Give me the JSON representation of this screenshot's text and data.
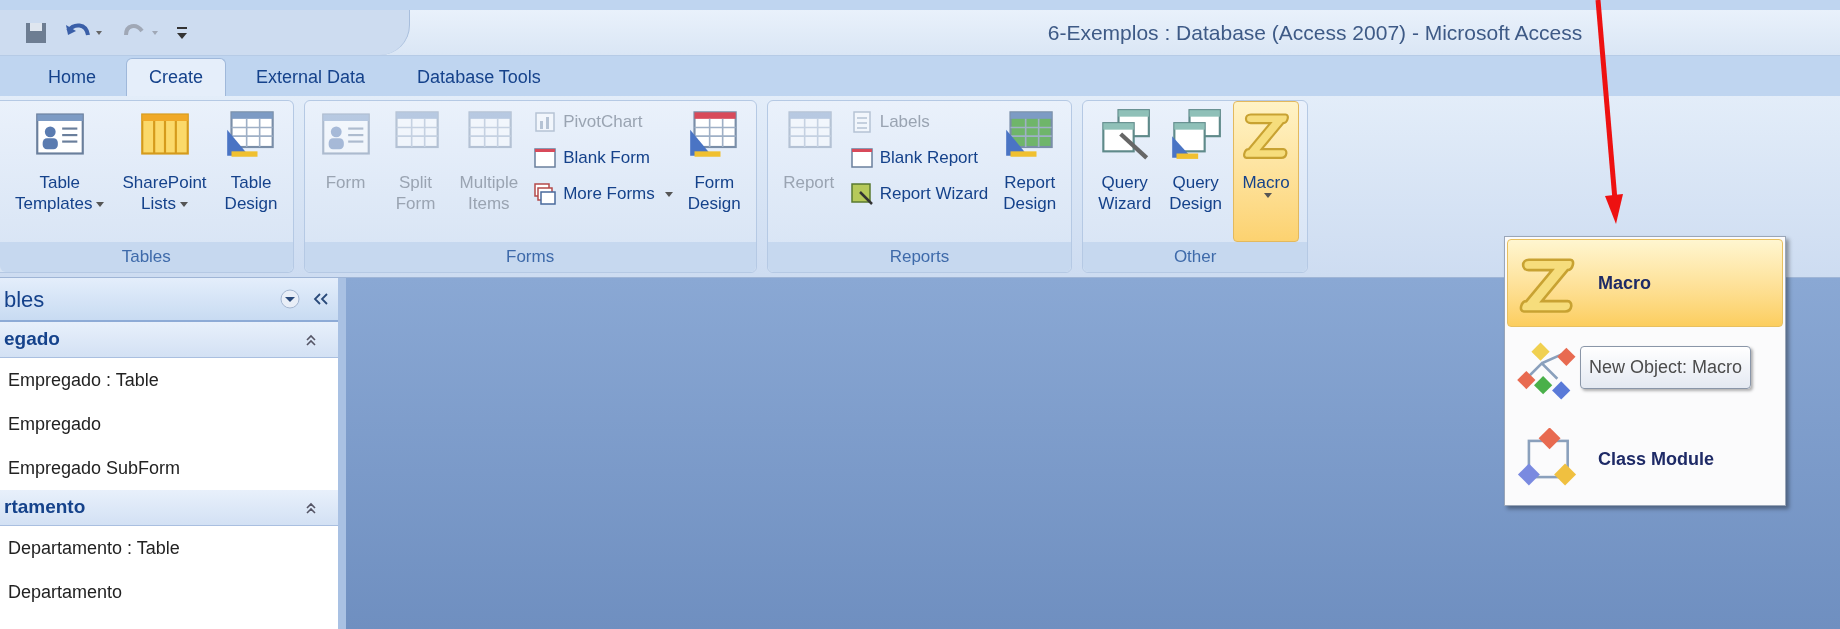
{
  "window": {
    "title": "6-Exemplos : Database (Access 2007) - Microsoft Access"
  },
  "tabs": [
    {
      "label": "Home",
      "selected": false
    },
    {
      "label": "Create",
      "selected": true
    },
    {
      "label": "External Data",
      "selected": false
    },
    {
      "label": "Database Tools",
      "selected": false
    }
  ],
  "ribbon_groups": [
    {
      "label": "Tables",
      "items": [
        {
          "kind": "large",
          "lines": [
            "Table",
            "Templates"
          ],
          "menu": true,
          "disabled": false
        },
        {
          "kind": "large",
          "lines": [
            "SharePoint",
            "Lists"
          ],
          "menu": true,
          "disabled": false
        },
        {
          "kind": "large",
          "lines": [
            "Table",
            "Design"
          ],
          "menu": false,
          "disabled": false
        }
      ]
    },
    {
      "label": "Forms",
      "items": [
        {
          "kind": "large",
          "lines": [
            "Form"
          ],
          "menu": false,
          "disabled": true
        },
        {
          "kind": "large",
          "lines": [
            "Split",
            "Form"
          ],
          "menu": false,
          "disabled": true
        },
        {
          "kind": "large",
          "lines": [
            "Multiple",
            "Items"
          ],
          "menu": false,
          "disabled": true
        },
        {
          "kind": "stack",
          "items": [
            {
              "label": "PivotChart",
              "menu": false,
              "disabled": true
            },
            {
              "label": "Blank Form",
              "menu": false,
              "disabled": false
            },
            {
              "label": "More Forms",
              "menu": true,
              "disabled": false
            }
          ]
        },
        {
          "kind": "large",
          "lines": [
            "Form",
            "Design"
          ],
          "menu": false,
          "disabled": false
        }
      ]
    },
    {
      "label": "Reports",
      "items": [
        {
          "kind": "large",
          "lines": [
            "Report"
          ],
          "menu": false,
          "disabled": true
        },
        {
          "kind": "stack",
          "items": [
            {
              "label": "Labels",
              "menu": false,
              "disabled": true
            },
            {
              "label": "Blank Report",
              "menu": false,
              "disabled": false
            },
            {
              "label": "Report Wizard",
              "menu": false,
              "disabled": false
            }
          ]
        },
        {
          "kind": "large",
          "lines": [
            "Report",
            "Design"
          ],
          "menu": false,
          "disabled": false
        }
      ]
    },
    {
      "label": "Other",
      "items": [
        {
          "kind": "large",
          "lines": [
            "Query",
            "Wizard"
          ],
          "menu": false,
          "disabled": false,
          "pressed": false
        },
        {
          "kind": "large",
          "lines": [
            "Query",
            "Design"
          ],
          "menu": false,
          "disabled": false,
          "pressed": false
        },
        {
          "kind": "large",
          "lines": [
            "Macro"
          ],
          "menu": true,
          "disabled": false,
          "pressed": true
        }
      ]
    }
  ],
  "navigation_pane": {
    "title": "bles",
    "groups": [
      {
        "label": "egado",
        "expanded": true,
        "items": [
          "Empregado : Table",
          "Empregado",
          "Empregado SubForm"
        ]
      },
      {
        "label": "rtamento",
        "expanded": true,
        "items": [
          "Departamento : Table",
          "Departamento"
        ]
      }
    ]
  },
  "dropdown_menu": {
    "items": [
      {
        "label": "Macro",
        "selected": true
      },
      {
        "selected": false
      },
      {
        "label": "Class Module",
        "selected": false
      }
    ]
  },
  "tooltip": {
    "text": "New Object: Macro"
  }
}
